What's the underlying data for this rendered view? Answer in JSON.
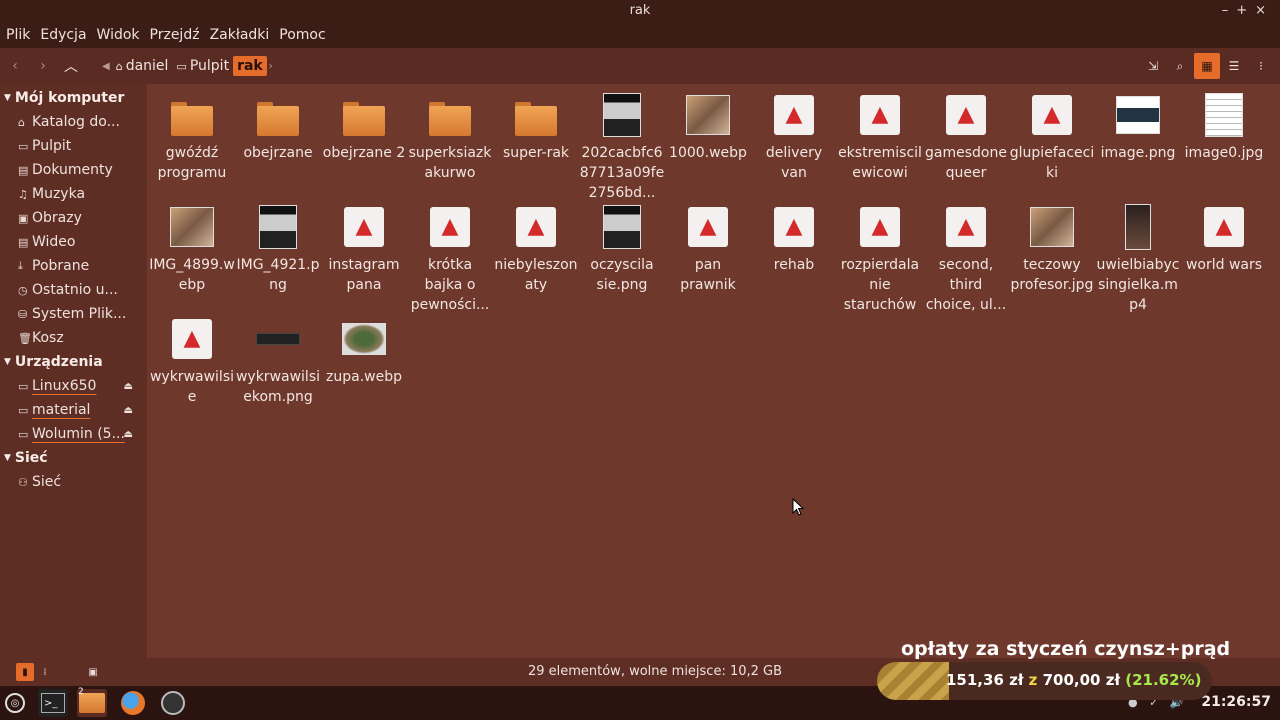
{
  "window": {
    "title": "rak",
    "controls": [
      "–",
      "+",
      "×"
    ]
  },
  "menu": [
    "Plik",
    "Edycja",
    "Widok",
    "Przejdź",
    "Zakładki",
    "Pomoc"
  ],
  "breadcrumb": [
    "daniel",
    "Pulpit",
    "rak"
  ],
  "sidebar": {
    "sections": [
      {
        "title": "Mój komputer",
        "items": [
          {
            "label": "Katalog do...",
            "icon": "home-icon"
          },
          {
            "label": "Pulpit",
            "icon": "folder-icon"
          },
          {
            "label": "Dokumenty",
            "icon": "document-icon"
          },
          {
            "label": "Muzyka",
            "icon": "music-icon"
          },
          {
            "label": "Obrazy",
            "icon": "image-icon"
          },
          {
            "label": "Wideo",
            "icon": "video-icon"
          },
          {
            "label": "Pobrane",
            "icon": "download-icon"
          },
          {
            "label": "Ostatnio u...",
            "icon": "recent-icon"
          },
          {
            "label": "System Plik...",
            "icon": "drive-icon"
          },
          {
            "label": "Kosz",
            "icon": "trash-icon"
          }
        ]
      },
      {
        "title": "Urządzenia",
        "items": [
          {
            "label": "Linux650",
            "icon": "drive-icon"
          },
          {
            "label": "material",
            "icon": "drive-icon"
          },
          {
            "label": "Wolumin (5...",
            "icon": "drive-icon"
          }
        ]
      },
      {
        "title": "Sieć",
        "items": [
          {
            "label": "Sieć",
            "icon": "network-icon"
          }
        ]
      }
    ]
  },
  "files": [
    {
      "name": "gwóźdź programu",
      "kind": "folder"
    },
    {
      "name": "obejrzane",
      "kind": "folder"
    },
    {
      "name": "obejrzane 2",
      "kind": "folder"
    },
    {
      "name": "superksiazkakurwo",
      "kind": "folder"
    },
    {
      "name": "super-rak",
      "kind": "folder"
    },
    {
      "name": "202cacbfc687713a09fe2756bd...",
      "kind": "image-dark"
    },
    {
      "name": "1000.webp",
      "kind": "image-photo"
    },
    {
      "name": "delivery van",
      "kind": "rocket"
    },
    {
      "name": "ekstremiscilewicowi",
      "kind": "rocket"
    },
    {
      "name": "gamesdonequeer",
      "kind": "rocket"
    },
    {
      "name": "glupiefaceciki",
      "kind": "rocket"
    },
    {
      "name": "image.png",
      "kind": "image-web"
    },
    {
      "name": "image0.jpg",
      "kind": "image-doc"
    },
    {
      "name": "IMG_4899.webp",
      "kind": "image-photo"
    },
    {
      "name": "IMG_4921.png",
      "kind": "image-dark"
    },
    {
      "name": "instagram pana",
      "kind": "rocket"
    },
    {
      "name": "krótka bajka o pewności...",
      "kind": "rocket"
    },
    {
      "name": "niebyleszonaty",
      "kind": "rocket"
    },
    {
      "name": "oczyscila sie.png",
      "kind": "image-dark"
    },
    {
      "name": "pan prawnik",
      "kind": "rocket"
    },
    {
      "name": "rehab",
      "kind": "rocket"
    },
    {
      "name": "rozpierdalanie staruchów",
      "kind": "rocket"
    },
    {
      "name": "second, third choice, ul...",
      "kind": "rocket"
    },
    {
      "name": "teczowy profesor.jpg",
      "kind": "image-photo"
    },
    {
      "name": "uwielbiabycsingielka.mp4",
      "kind": "video"
    },
    {
      "name": "world wars",
      "kind": "rocket"
    },
    {
      "name": "wykrwawilsie",
      "kind": "rocket"
    },
    {
      "name": "wykrwawilsiekom.png",
      "kind": "image-strip"
    },
    {
      "name": "zupa.webp",
      "kind": "image-soup"
    }
  ],
  "status": "29 elementów, wolne miejsce: 10,2 GB",
  "taskbar": {
    "clock": "21:26:57",
    "badge": "2"
  },
  "overlay": {
    "title": "opłaty za styczeń czynsz+prąd",
    "paid": "151,36 zł",
    "sep": "z",
    "total": "700,00 zł",
    "percent": "(21.62%)",
    "progress": 0.2162
  },
  "colors": {
    "accent": "#e66c2c",
    "background": "#6e382c",
    "sidebar": "#5e2e24"
  }
}
